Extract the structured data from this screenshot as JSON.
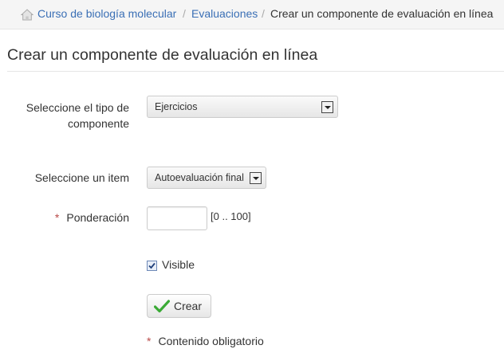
{
  "breadcrumb": {
    "items": [
      {
        "label": "Curso de biología molecular"
      },
      {
        "label": "Evaluaciones"
      }
    ],
    "separator": "/",
    "current": "Crear un componente de evaluación en línea"
  },
  "page": {
    "title": "Crear un componente de evaluación en línea"
  },
  "form": {
    "tipo": {
      "label_line1": "Seleccione el tipo de",
      "label_line2": "componente",
      "value": "Ejercicios"
    },
    "item": {
      "label": "Seleccione un item",
      "value": "Autoevaluación final"
    },
    "ponderacion": {
      "required_mark": "*",
      "label": "Ponderación",
      "value": "",
      "range_hint": "[0 .. 100]"
    },
    "visible": {
      "label": "Visible",
      "checked": true
    },
    "submit_label": "Crear",
    "required_note_mark": "*",
    "required_note": "Contenido obligatorio"
  },
  "colors": {
    "link": "#3a6fb5",
    "required": "#b94a48",
    "check_icon": "#3aaa35"
  },
  "icons": {
    "home": "home-icon",
    "dropdown": "chevron-down-icon",
    "checkmark": "checkmark-icon"
  }
}
